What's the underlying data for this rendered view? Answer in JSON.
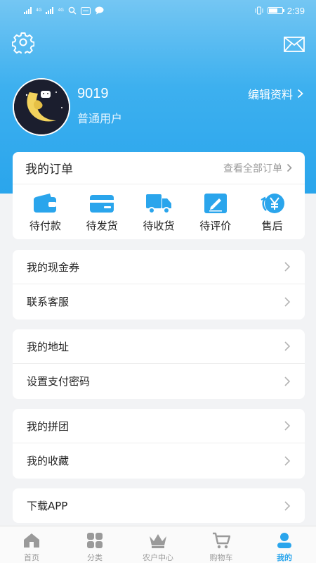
{
  "status_bar": {
    "net_label": "4G",
    "time": "2:39"
  },
  "colors": {
    "accent": "#2aa5ec",
    "icon_blue": "#2aa5ec",
    "text_gray": "#9a9a9a"
  },
  "header": {
    "settings_icon": "gear-icon",
    "message_icon": "mail-icon",
    "username": "9019",
    "user_type": "普通用户",
    "edit_profile": "编辑资料"
  },
  "orders": {
    "title": "我的订单",
    "view_all": "查看全部订单",
    "items": [
      {
        "label": "待付款",
        "icon": "wallet-icon"
      },
      {
        "label": "待发货",
        "icon": "card-icon"
      },
      {
        "label": "待收货",
        "icon": "truck-icon"
      },
      {
        "label": "待评价",
        "icon": "review-pen-icon"
      },
      {
        "label": "售后",
        "icon": "yen-refund-icon"
      }
    ]
  },
  "menu_groups": [
    [
      "我的现金券",
      "联系客服"
    ],
    [
      "我的地址",
      "设置支付密码"
    ],
    [
      "我的拼团",
      "我的收藏"
    ],
    [
      "下载APP"
    ]
  ],
  "tabs": [
    {
      "label": "首页",
      "icon": "home-icon"
    },
    {
      "label": "分类",
      "icon": "category-icon"
    },
    {
      "label": "农户中心",
      "icon": "crown-icon"
    },
    {
      "label": "购物车",
      "icon": "cart-icon"
    },
    {
      "label": "我的",
      "icon": "user-icon",
      "active": true
    }
  ]
}
